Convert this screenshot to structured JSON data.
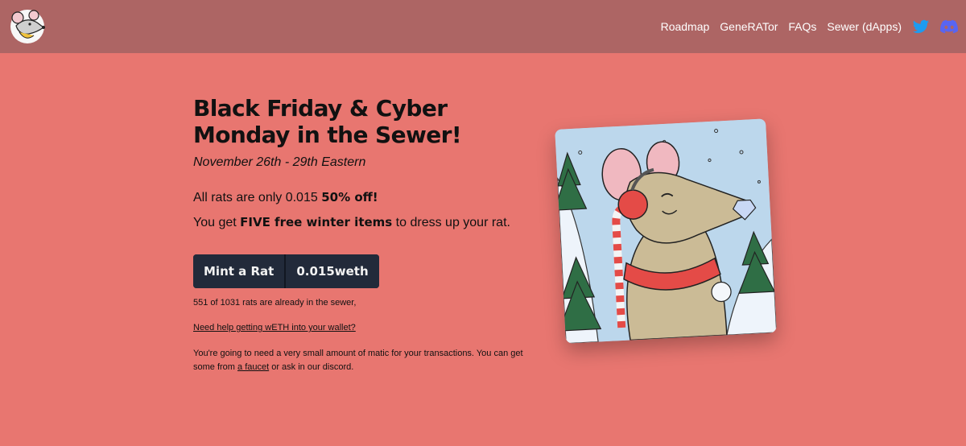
{
  "nav": {
    "logo_name": "rat-logo",
    "links": [
      "Roadmap",
      "GeneRATor",
      "FAQs",
      "Sewer (dApps)"
    ],
    "social": [
      "twitter-icon",
      "discord-icon"
    ]
  },
  "hero": {
    "title_line1": "Black Friday & Cyber",
    "title_line2": "Monday in the Sewer!",
    "dates": "November 26th - 29th Eastern",
    "promo1_text": "All rats are only 0.015 ",
    "promo1_bold": "50% off!",
    "promo2_pre": "You get ",
    "promo2_bold": "FIVE free winter items",
    "promo2_post": " to dress up your rat.",
    "mint_label": "Mint a Rat",
    "price_label": "0.015weth",
    "supply_text": "551 of 1031 rats are already in the sewer,",
    "help_link": "Need help getting wETH into your wallet?",
    "note_pre": "You're going to need a very small amount of matic for your transactions. You can get some from ",
    "note_link": "a faucet",
    "note_post": " or ask in our discord."
  },
  "colors": {
    "background": "#e87670",
    "navbar": "#ad6564",
    "button": "#222a3a",
    "twitter": "#1d9bf0",
    "discord": "#5865f2"
  }
}
